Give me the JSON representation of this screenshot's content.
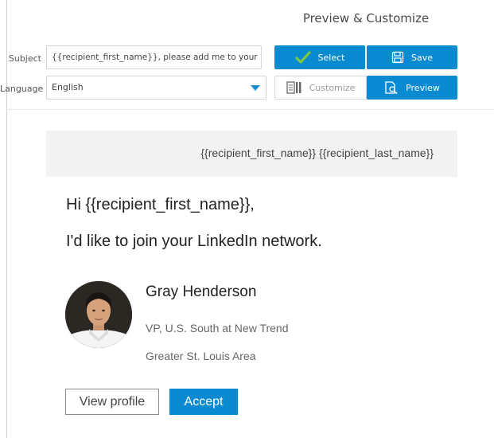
{
  "header": {
    "title": "Preview & Customize"
  },
  "form": {
    "subject_label": "Subject",
    "subject_value": "{{recipient_first_name}}, please add me to your LinkedIn",
    "language_label": "Language",
    "language_value": "English"
  },
  "toolbar": {
    "select_label": "Select",
    "save_label": "Save",
    "customize_label": "Customize",
    "preview_label": "Preview"
  },
  "preview": {
    "recipient_line": "{{recipient_first_name}} {{recipient_last_name}}",
    "greeting": "Hi {{recipient_first_name}},",
    "message": "I'd like to join your LinkedIn network.",
    "profile": {
      "name": "Gray Henderson",
      "title": "VP, U.S. South at New Trend",
      "location": "Greater St. Louis Area"
    },
    "view_profile_label": "View profile",
    "accept_label": "Accept"
  },
  "colors": {
    "accent": "#0a8ad0",
    "check": "#7bc943"
  },
  "icons": [
    "check-icon",
    "save-disk-icon",
    "document-icon",
    "preview-icon",
    "chevron-down-icon"
  ]
}
